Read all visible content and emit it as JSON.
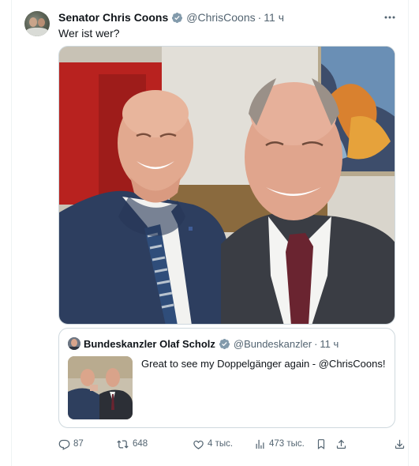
{
  "tweet": {
    "author_name": "Senator Chris Coons",
    "handle": "@ChrisCoons",
    "separator": "·",
    "time": "11 ч",
    "text": "Wer ist wer?",
    "verified_color": "#829aab"
  },
  "quoted": {
    "author_name": "Bundeskanzler Olaf Scholz",
    "handle": "@Bundeskanzler",
    "separator": "·",
    "time": "11 ч",
    "text": "Great to see my Doppelgänger again - @ChrisCoons!"
  },
  "actions": {
    "replies": "87",
    "retweets": "648",
    "likes": "4 тыс.",
    "views": "473 тыс."
  },
  "icons": [
    "more-icon",
    "verified-badge-icon",
    "reply-icon",
    "retweet-icon",
    "like-icon",
    "views-icon",
    "bookmark-icon",
    "share-icon",
    "download-icon"
  ],
  "colors": {
    "text": "#0f1419",
    "secondary": "#536471",
    "border": "#cfd9de"
  }
}
